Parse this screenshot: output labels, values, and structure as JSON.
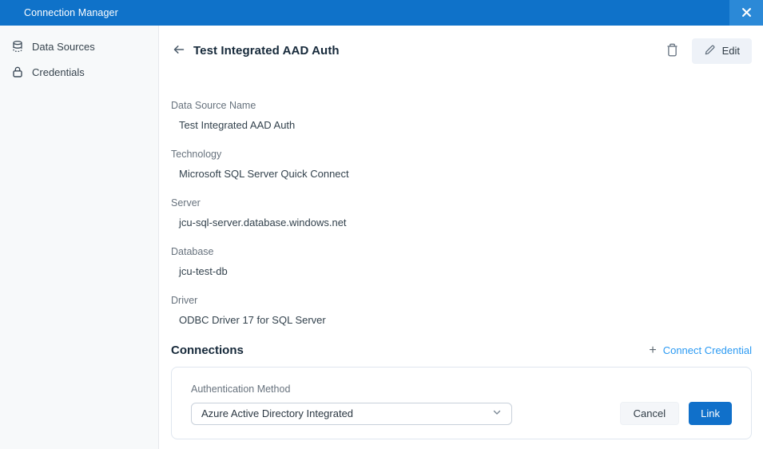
{
  "titlebar": {
    "title": "Connection Manager"
  },
  "sidebar": {
    "items": [
      {
        "label": "Data Sources",
        "icon": "database-icon"
      },
      {
        "label": "Credentials",
        "icon": "lock-icon"
      }
    ]
  },
  "header": {
    "title": "Test Integrated AAD Auth",
    "edit_label": "Edit"
  },
  "fields": [
    {
      "label": "Data Source Name",
      "value": "Test Integrated AAD Auth"
    },
    {
      "label": "Technology",
      "value": "Microsoft SQL Server Quick Connect"
    },
    {
      "label": "Server",
      "value": "jcu-sql-server.database.windows.net"
    },
    {
      "label": "Database",
      "value": "jcu-test-db"
    },
    {
      "label": "Driver",
      "value": "ODBC Driver 17 for SQL Server"
    }
  ],
  "connections": {
    "title": "Connections",
    "plus": "+",
    "connect_credential_label": "Connect Credential",
    "auth_method_label": "Authentication Method",
    "auth_method_value": "Azure Active Directory Integrated",
    "cancel_label": "Cancel",
    "link_label": "Link"
  },
  "colors": {
    "titlebar_blue": "#0f72c9",
    "close_button_blue": "#2b89d7",
    "primary_button_blue": "#1070ca",
    "link_blue": "#2b9af3",
    "sidebar_bg": "#f7f9fa",
    "label_gray": "#67727d",
    "value_dark": "#33424d",
    "heading_dark": "#16293a",
    "card_border": "#dfe6ef"
  }
}
